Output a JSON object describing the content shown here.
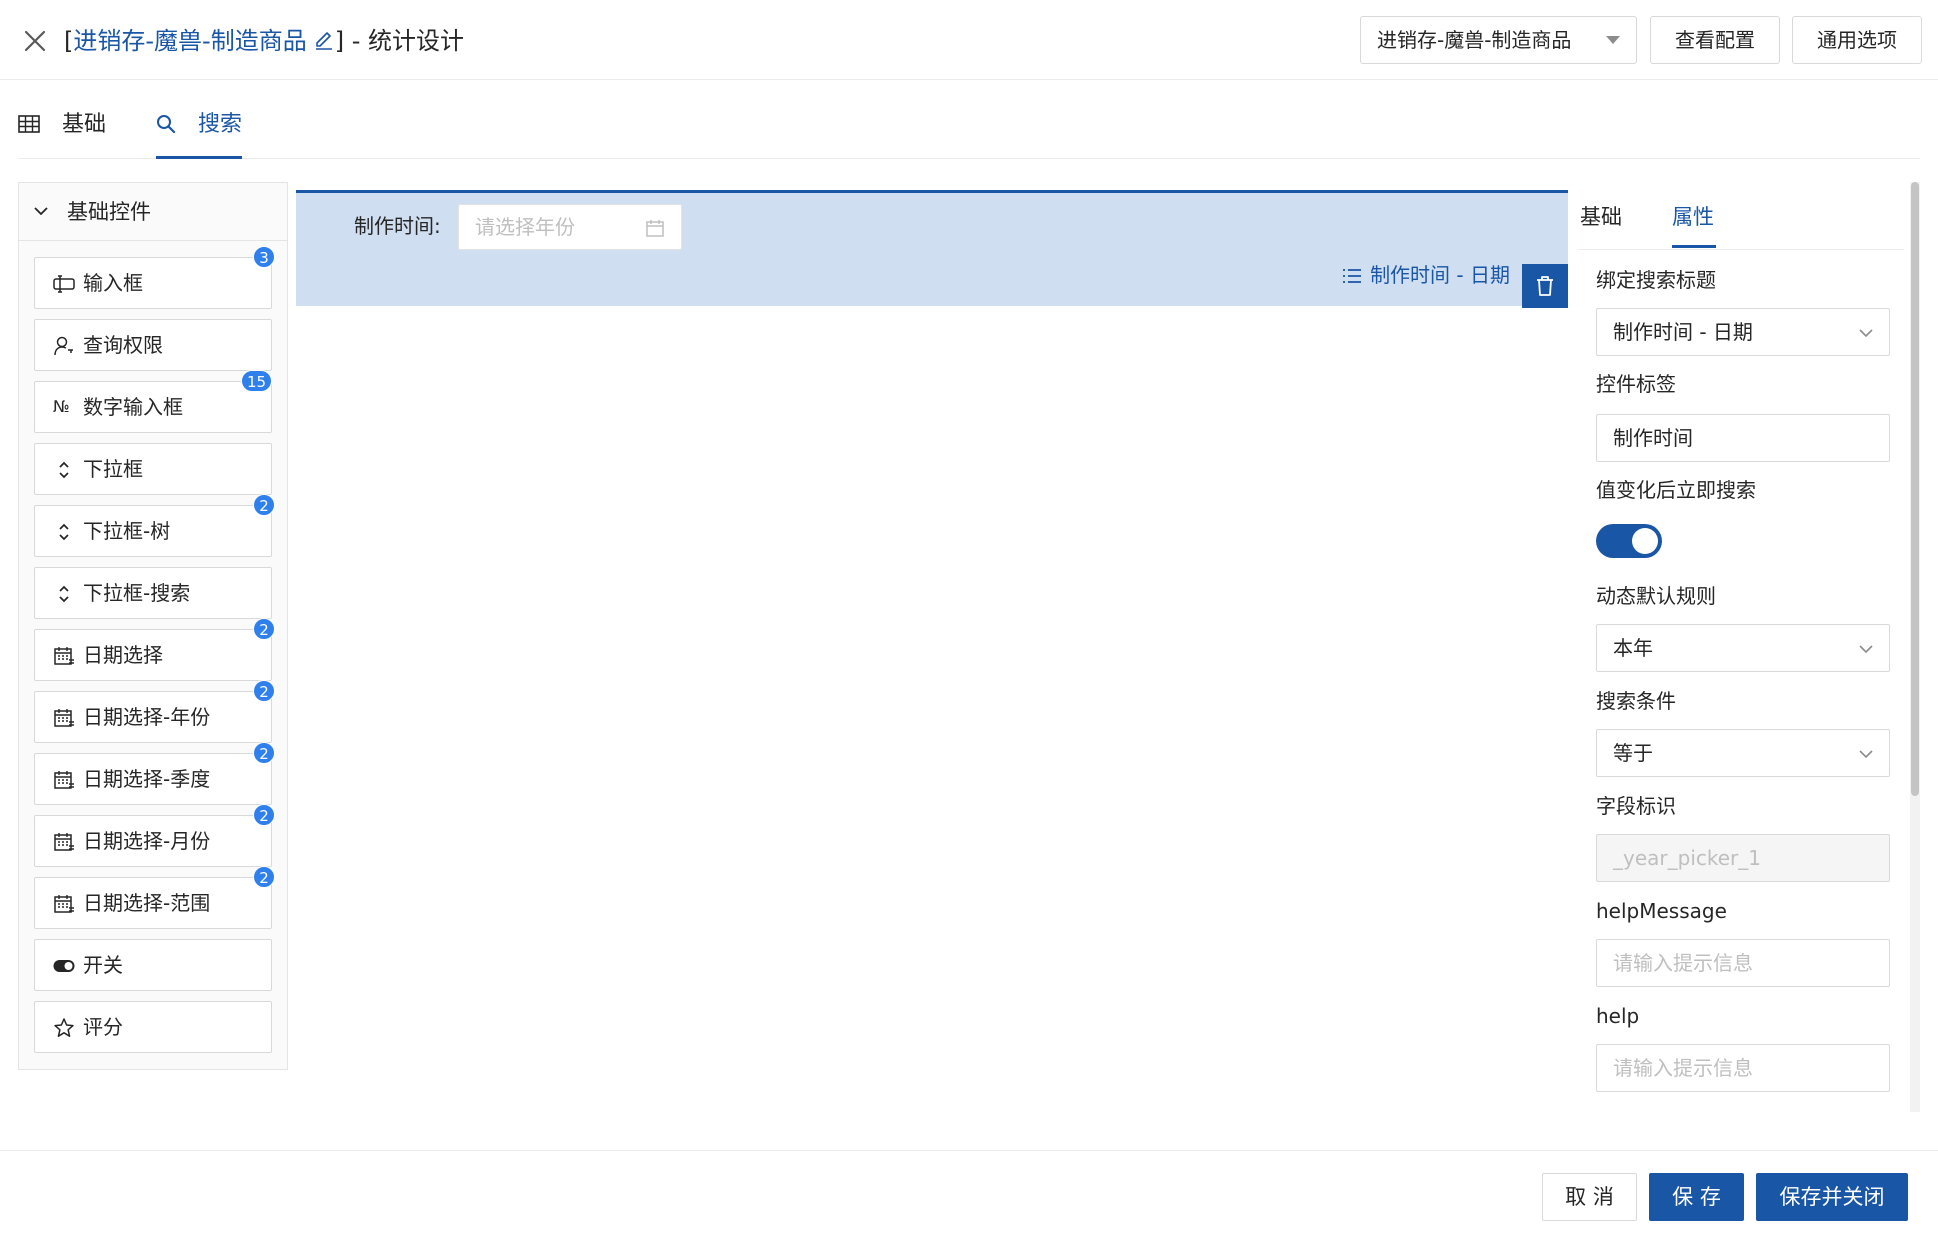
{
  "header": {
    "title_open": "[",
    "app_name": "进销存-魔兽-制造商品",
    "title_rest": "] - 统计设计",
    "app_select_value": "进销存-魔兽-制造商品",
    "view_config_label": "查看配置",
    "common_options_label": "通用选项"
  },
  "tabs": [
    {
      "label": "基础"
    },
    {
      "label": "搜索"
    }
  ],
  "left_panel": {
    "group_title": "基础控件",
    "controls": [
      {
        "label": "输入框",
        "badge": "3"
      },
      {
        "label": "查询权限",
        "badge": ""
      },
      {
        "label": "数字输入框",
        "badge": "15"
      },
      {
        "label": "下拉框",
        "badge": ""
      },
      {
        "label": "下拉框-树",
        "badge": "2"
      },
      {
        "label": "下拉框-搜索",
        "badge": ""
      },
      {
        "label": "日期选择",
        "badge": "2"
      },
      {
        "label": "日期选择-年份",
        "badge": "2"
      },
      {
        "label": "日期选择-季度",
        "badge": "2"
      },
      {
        "label": "日期选择-月份",
        "badge": "2"
      },
      {
        "label": "日期选择-范围",
        "badge": "2"
      },
      {
        "label": "开关",
        "badge": ""
      },
      {
        "label": "评分",
        "badge": ""
      }
    ]
  },
  "canvas": {
    "field_label": "制作时间:",
    "field_placeholder": "请选择年份",
    "field_tag": "制作时间 - 日期"
  },
  "right_panel": {
    "tabs": [
      {
        "label": "基础"
      },
      {
        "label": "属性"
      }
    ],
    "bind_title_label": "绑定搜索标题",
    "bind_title_value": "制作时间 - 日期",
    "control_label_label": "控件标签",
    "control_label_value": "制作时间",
    "instant_search_label": "值变化后立即搜索",
    "instant_search_on": true,
    "default_rule_label": "动态默认规则",
    "default_rule_value": "本年",
    "condition_label": "搜索条件",
    "condition_value": "等于",
    "field_id_label": "字段标识",
    "field_id_value": "_year_picker_1",
    "help_message_label": "helpMessage",
    "help_message_placeholder": "请输入提示信息",
    "help_label": "help",
    "help_placeholder": "请输入提示信息"
  },
  "footer": {
    "cancel_label": "取 消",
    "save_label": "保 存",
    "save_close_label": "保存并关闭"
  },
  "colors": {
    "primary": "#1a56a6",
    "badge": "#2f80ed",
    "selected_bg": "#cfdff1"
  }
}
